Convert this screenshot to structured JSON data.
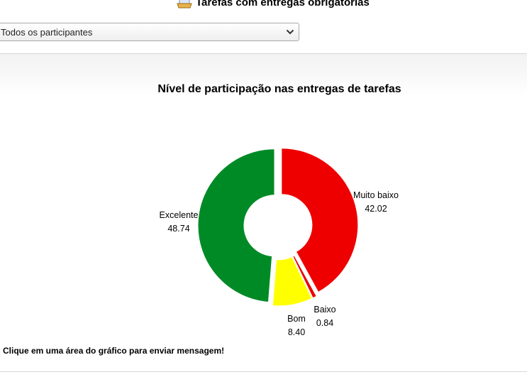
{
  "header": {
    "title": "Tarefas com entregas obrigatórias"
  },
  "filter": {
    "selected": "Todos os participantes"
  },
  "chart_data": {
    "type": "pie",
    "title": "Nível de participação nas entregas de tarefas",
    "donut": true,
    "slices": [
      {
        "label": "Muito baixo",
        "value": 42.02,
        "color": "#ee0000"
      },
      {
        "label": "Baixo",
        "value": 0.84,
        "color": "#ee0000"
      },
      {
        "label": "Bom",
        "value": 8.4,
        "color": "#ffff00"
      },
      {
        "label": "Excelente",
        "value": 48.74,
        "color": "#008a26"
      }
    ]
  },
  "footer": {
    "note": "Clique em uma área do gráfico para enviar mensagem!"
  }
}
